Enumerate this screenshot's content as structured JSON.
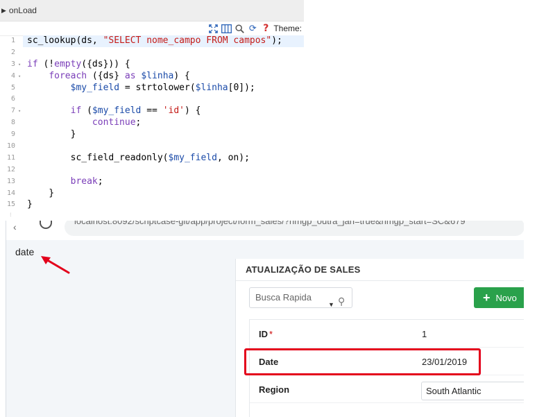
{
  "editor": {
    "event_name": "onLoad",
    "toolbar": {
      "icons": [
        "fullscreen-icon",
        "columns-icon",
        "search-icon",
        "refresh-icon",
        "help-icon"
      ],
      "theme_label": "Theme:"
    },
    "lines": [
      {
        "num": "1",
        "fold": false,
        "html": "sc_lookup(ds, <span class='s'>\"SELECT nome_campo FROM campos\"</span>);"
      },
      {
        "num": "2",
        "fold": false,
        "html": ""
      },
      {
        "num": "3",
        "fold": true,
        "html": "<span class='k'>if</span> (!<span class='k'>empty</span>({ds})) {"
      },
      {
        "num": "4",
        "fold": true,
        "html": "    <span class='k'>foreach</span> ({ds} <span class='k'>as</span> <span class='v'>$linha</span>) {"
      },
      {
        "num": "5",
        "fold": false,
        "html": "        <span class='v'>$my_field</span> = strtolower(<span class='v'>$linha</span>[0]);"
      },
      {
        "num": "6",
        "fold": false,
        "html": ""
      },
      {
        "num": "7",
        "fold": true,
        "html": "        <span class='k'>if</span> (<span class='v'>$my_field</span> == <span class='s'>'id'</span>) {"
      },
      {
        "num": "8",
        "fold": false,
        "html": "            <span class='k'>continue</span>;"
      },
      {
        "num": "9",
        "fold": false,
        "html": "        }"
      },
      {
        "num": "10",
        "fold": false,
        "html": ""
      },
      {
        "num": "11",
        "fold": false,
        "html": "        sc_field_readonly(<span class='v'>$my_field</span>, on);"
      },
      {
        "num": "12",
        "fold": false,
        "html": ""
      },
      {
        "num": "13",
        "fold": false,
        "html": "        <span class='k'>break</span>;"
      },
      {
        "num": "14",
        "fold": false,
        "html": "    }"
      },
      {
        "num": "15",
        "fold": false,
        "html": "}"
      }
    ]
  },
  "browser": {
    "url": "localhost:8092/scriptcase-git/app/project/form_sales/?nmgp_outra_jan=true&nmgp_start=SC&679",
    "field_name_output": "date"
  },
  "app": {
    "title": "ATUALIZAÇÃO DE SALES",
    "quick_search_placeholder": "Busca Rapida",
    "new_button_label": "Novo",
    "fields": [
      {
        "label": "ID",
        "required": "*",
        "value": "1",
        "type": "text"
      },
      {
        "label": "Date",
        "required": "",
        "value": "23/01/2019",
        "type": "text"
      },
      {
        "label": "Region",
        "required": "",
        "value": "South Atlantic",
        "type": "select"
      }
    ]
  },
  "colors": {
    "accent_green": "#2aa14b",
    "highlight_red": "#e3001b"
  }
}
